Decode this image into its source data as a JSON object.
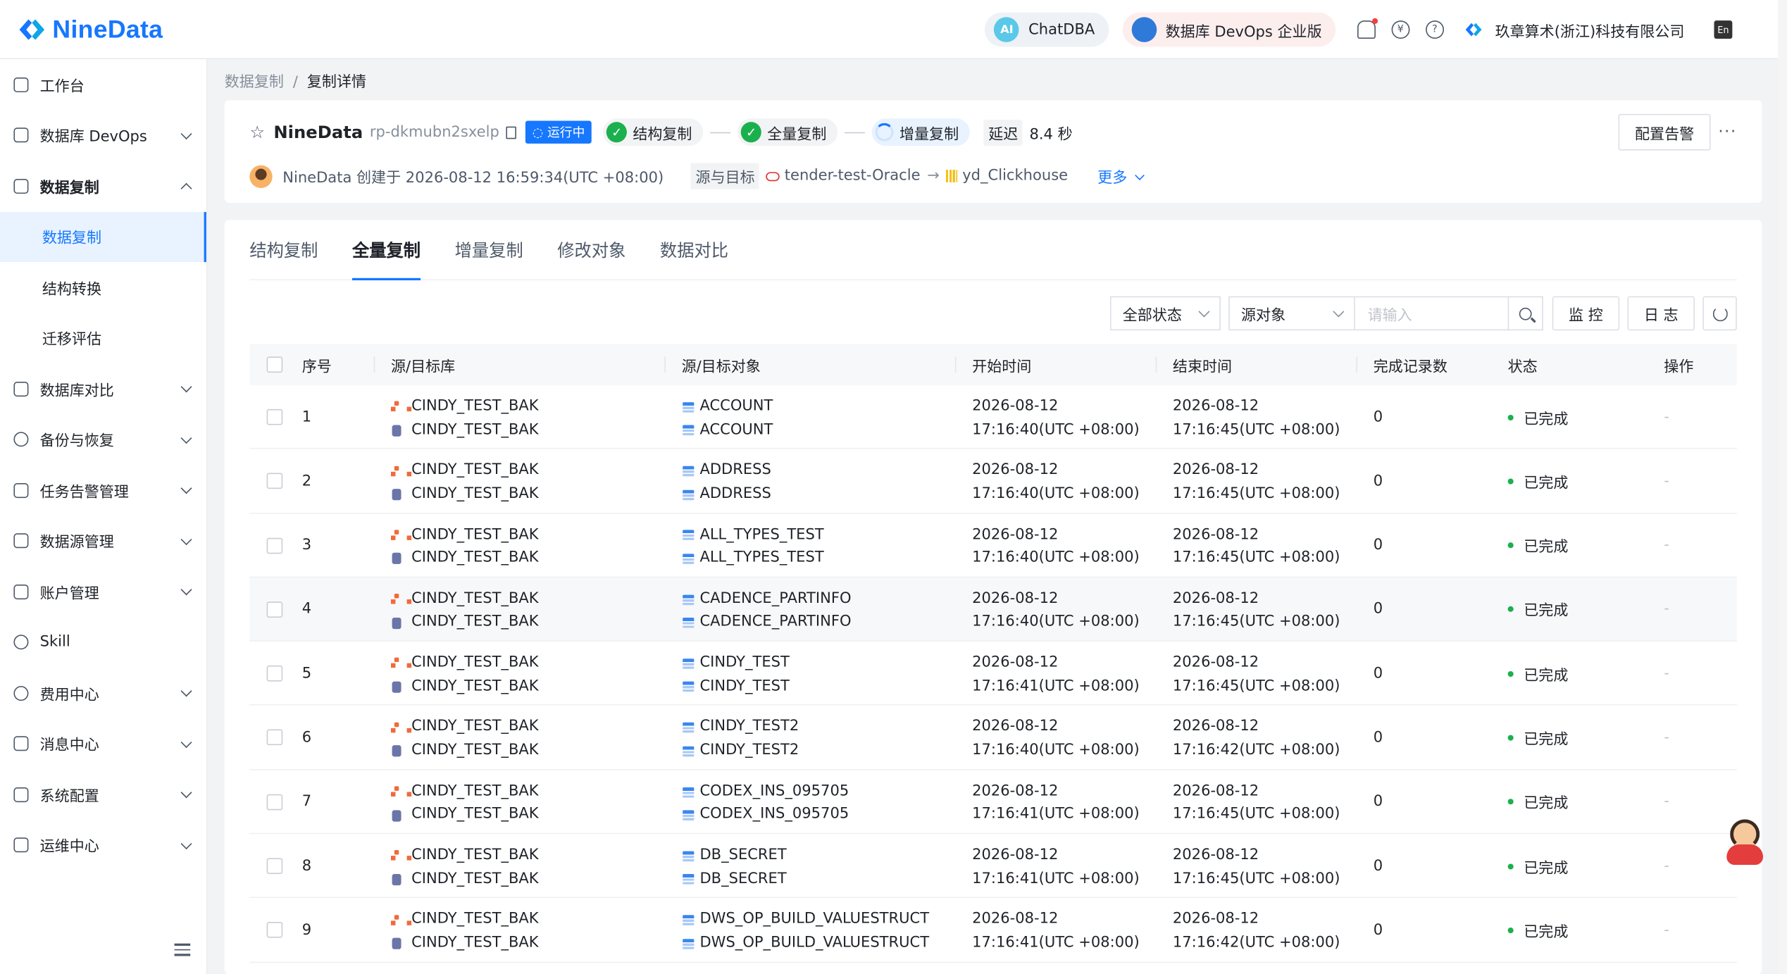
{
  "brand": {
    "name": "NineData",
    "color": "#1677ff"
  },
  "header": {
    "chatdba_label": "ChatDBA",
    "devops_label": "数据库 DevOps 企业版",
    "company_name": "玖章算术(浙江)科技有限公司",
    "icons": [
      "bell-icon",
      "yen-icon",
      "help-icon",
      "language-icon"
    ]
  },
  "sidebar": {
    "items": [
      {
        "label": "工作台",
        "icon": "home-icon"
      },
      {
        "label": "数据库 DevOps",
        "icon": "monitor-icon",
        "expandable": true
      },
      {
        "label": "数据复制",
        "icon": "copy-icon",
        "expanded": true
      },
      {
        "label": "数据复制",
        "sub": true,
        "active": true
      },
      {
        "label": "结构转换",
        "sub": true
      },
      {
        "label": "迁移评估",
        "sub": true
      },
      {
        "label": "数据库对比",
        "icon": "compare-icon",
        "expandable": true
      },
      {
        "label": "备份与恢复",
        "icon": "cloud-icon",
        "expandable": true
      },
      {
        "label": "任务告警管理",
        "icon": "alarm-icon",
        "expandable": true
      },
      {
        "label": "数据源管理",
        "icon": "datasource-icon",
        "expandable": true
      },
      {
        "label": "账户管理",
        "icon": "account-icon",
        "expandable": true
      },
      {
        "label": "Skill",
        "icon": "skill-icon"
      },
      {
        "label": "费用中心",
        "icon": "yen-icon",
        "expandable": true
      },
      {
        "label": "消息中心",
        "icon": "mail-icon",
        "expandable": true
      },
      {
        "label": "系统配置",
        "icon": "grid-icon",
        "expandable": true
      },
      {
        "label": "运维中心",
        "icon": "wrench-icon",
        "expandable": true
      }
    ]
  },
  "breadcrumb": {
    "parent": "数据复制",
    "separator": "/",
    "current": "复制详情"
  },
  "task": {
    "name": "NineData",
    "id": "rp-dkmubn2sxelp",
    "status": "运行中",
    "stages": [
      "结构复制",
      "全量复制",
      "增量复制"
    ],
    "delay_label": "延迟",
    "delay_value": "8.4 秒",
    "creator_text": "NineData 创建于 2026-08-12 16:59:34(UTC +08:00)",
    "source_target_label": "源与目标",
    "source": "tender-test-Oracle",
    "target": "yd_Clickhouse",
    "more_label": "更多",
    "alarm_button": "配置告警"
  },
  "tabs": [
    "结构复制",
    "全量复制",
    "增量复制",
    "修改对象",
    "数据对比"
  ],
  "active_tab": 1,
  "toolbar": {
    "status_filter": "全部状态",
    "object_filter": "源对象",
    "search_placeholder": "请输入",
    "monitor_button": "监 控",
    "log_button": "日 志"
  },
  "table": {
    "headers": {
      "index": "序号",
      "db": "源/目标库",
      "object": "源/目标对象",
      "start": "开始时间",
      "end": "结束时间",
      "records": "完成记录数",
      "status": "状态",
      "action": "操作"
    },
    "rows": [
      {
        "index": "1",
        "src_db": "CINDY_TEST_BAK",
        "dst_db": "CINDY_TEST_BAK",
        "src_obj": "ACCOUNT",
        "dst_obj": "ACCOUNT",
        "start_date": "2026-08-12",
        "start_time": "17:16:40(UTC +08:00)",
        "end_date": "2026-08-12",
        "end_time": "17:16:45(UTC +08:00)",
        "records": "0",
        "status": "已完成",
        "action": "-"
      },
      {
        "index": "2",
        "src_db": "CINDY_TEST_BAK",
        "dst_db": "CINDY_TEST_BAK",
        "src_obj": "ADDRESS",
        "dst_obj": "ADDRESS",
        "start_date": "2026-08-12",
        "start_time": "17:16:40(UTC +08:00)",
        "end_date": "2026-08-12",
        "end_time": "17:16:45(UTC +08:00)",
        "records": "0",
        "status": "已完成",
        "action": "-"
      },
      {
        "index": "3",
        "src_db": "CINDY_TEST_BAK",
        "dst_db": "CINDY_TEST_BAK",
        "src_obj": "ALL_TYPES_TEST",
        "dst_obj": "ALL_TYPES_TEST",
        "start_date": "2026-08-12",
        "start_time": "17:16:40(UTC +08:00)",
        "end_date": "2026-08-12",
        "end_time": "17:16:45(UTC +08:00)",
        "records": "0",
        "status": "已完成",
        "action": "-"
      },
      {
        "index": "4",
        "src_db": "CINDY_TEST_BAK",
        "dst_db": "CINDY_TEST_BAK",
        "src_obj": "CADENCE_PARTINFO",
        "dst_obj": "CADENCE_PARTINFO",
        "start_date": "2026-08-12",
        "start_time": "17:16:40(UTC +08:00)",
        "end_date": "2026-08-12",
        "end_time": "17:16:45(UTC +08:00)",
        "records": "0",
        "status": "已完成",
        "action": "-"
      },
      {
        "index": "5",
        "src_db": "CINDY_TEST_BAK",
        "dst_db": "CINDY_TEST_BAK",
        "src_obj": "CINDY_TEST",
        "dst_obj": "CINDY_TEST",
        "start_date": "2026-08-12",
        "start_time": "17:16:41(UTC +08:00)",
        "end_date": "2026-08-12",
        "end_time": "17:16:45(UTC +08:00)",
        "records": "0",
        "status": "已完成",
        "action": "-"
      },
      {
        "index": "6",
        "src_db": "CINDY_TEST_BAK",
        "dst_db": "CINDY_TEST_BAK",
        "src_obj": "CINDY_TEST2",
        "dst_obj": "CINDY_TEST2",
        "start_date": "2026-08-12",
        "start_time": "17:16:40(UTC +08:00)",
        "end_date": "2026-08-12",
        "end_time": "17:16:42(UTC +08:00)",
        "records": "0",
        "status": "已完成",
        "action": "-"
      },
      {
        "index": "7",
        "src_db": "CINDY_TEST_BAK",
        "dst_db": "CINDY_TEST_BAK",
        "src_obj": "CODEX_INS_095705",
        "dst_obj": "CODEX_INS_095705",
        "start_date": "2026-08-12",
        "start_time": "17:16:41(UTC +08:00)",
        "end_date": "2026-08-12",
        "end_time": "17:16:45(UTC +08:00)",
        "records": "0",
        "status": "已完成",
        "action": "-"
      },
      {
        "index": "8",
        "src_db": "CINDY_TEST_BAK",
        "dst_db": "CINDY_TEST_BAK",
        "src_obj": "DB_SECRET",
        "dst_obj": "DB_SECRET",
        "start_date": "2026-08-12",
        "start_time": "17:16:41(UTC +08:00)",
        "end_date": "2026-08-12",
        "end_time": "17:16:45(UTC +08:00)",
        "records": "0",
        "status": "已完成",
        "action": "-"
      },
      {
        "index": "9",
        "src_db": "CINDY_TEST_BAK",
        "dst_db": "CINDY_TEST_BAK",
        "src_obj": "DWS_OP_BUILD_VALUESTRUCT",
        "dst_obj": "DWS_OP_BUILD_VALUESTRUCT",
        "start_date": "2026-08-12",
        "start_time": "17:16:41(UTC +08:00)",
        "end_date": "2026-08-12",
        "end_time": "17:16:42(UTC +08:00)",
        "records": "0",
        "status": "已完成",
        "action": "-"
      }
    ]
  }
}
